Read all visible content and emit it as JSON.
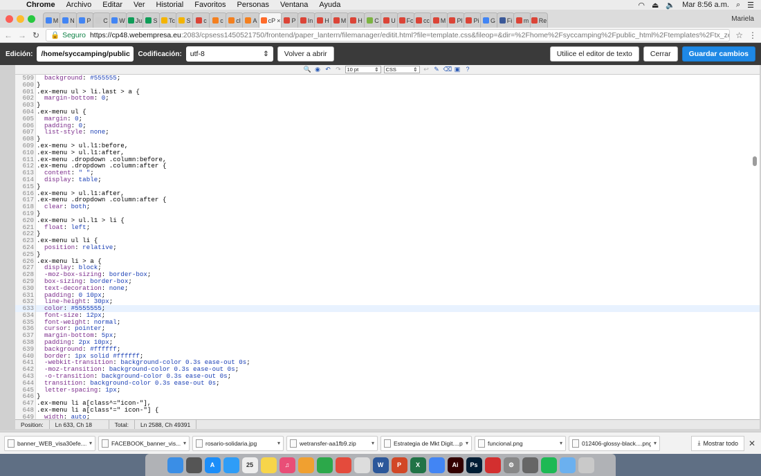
{
  "menubar": {
    "app": "Chrome",
    "items": [
      "Archivo",
      "Editar",
      "Ver",
      "Historial",
      "Favoritos",
      "Personas",
      "Ventana",
      "Ayuda"
    ],
    "clock": "Mar 8:56 a.m."
  },
  "tabs": [
    {
      "label": "M",
      "color": "#4285f4"
    },
    {
      "label": "N",
      "color": "#4285f4"
    },
    {
      "label": "P",
      "color": "#4285f4"
    },
    {
      "label": "C",
      "color": "#cccccc"
    },
    {
      "label": "W",
      "color": "#4285f4"
    },
    {
      "label": "Ju",
      "color": "#0f9d58"
    },
    {
      "label": "S",
      "color": "#0f9d58"
    },
    {
      "label": "Tc",
      "color": "#f4b400"
    },
    {
      "label": "S",
      "color": "#f4b400"
    },
    {
      "label": "c",
      "color": "#db4437"
    },
    {
      "label": "c",
      "color": "#f4801f"
    },
    {
      "label": "cl",
      "color": "#f4801f"
    },
    {
      "label": "A",
      "color": "#f4801f"
    },
    {
      "label": "cP",
      "color": "#ff6c2c",
      "active": true
    },
    {
      "label": "P",
      "color": "#db4437"
    },
    {
      "label": "In",
      "color": "#db4437"
    },
    {
      "label": "H",
      "color": "#db4437"
    },
    {
      "label": "M",
      "color": "#db4437"
    },
    {
      "label": "H",
      "color": "#db4437"
    },
    {
      "label": "C",
      "color": "#7cb342"
    },
    {
      "label": "U",
      "color": "#db4437"
    },
    {
      "label": "Fc",
      "color": "#db4437"
    },
    {
      "label": "cc",
      "color": "#db4437"
    },
    {
      "label": "M",
      "color": "#db4437"
    },
    {
      "label": "Pl",
      "color": "#db4437"
    },
    {
      "label": "Pi",
      "color": "#db4437"
    },
    {
      "label": "G",
      "color": "#4285f4"
    },
    {
      "label": "Fi",
      "color": "#3b5998"
    },
    {
      "label": "m",
      "color": "#db4437"
    },
    {
      "label": "Re",
      "color": "#db4437"
    }
  ],
  "profile": "Mariela",
  "address": {
    "secure_label": "Seguro",
    "host": "https://cp48.webempresa.eu",
    "path": ":2083/cpsess1450521750/frontend/paper_lantern/filemanager/editit.html?file=template.css&fileop=&dir=%2Fhome%2Fsyccamping%2Fpublic_html%2Ftemplates%2Ftx_zenith%2Fcss&d..."
  },
  "editor_header": {
    "edit_label": "Edición:",
    "path": "/home/syccamping/public",
    "encoding_label": "Codificación:",
    "encoding": "utf-8",
    "reopen": "Volver a abrir",
    "use_text_editor": "Utilice el editor de texto",
    "close": "Cerrar",
    "save": "Guardar cambios"
  },
  "toolbar": {
    "font_size": "10 pt",
    "syntax": "CSS"
  },
  "code": [
    {
      "n": "599",
      "t": "  background: #555555;"
    },
    {
      "n": "600",
      "t": "}"
    },
    {
      "n": "601",
      "t": ".ex-menu ul > li.last > a {"
    },
    {
      "n": "602",
      "t": "  margin-bottom: 0;"
    },
    {
      "n": "603",
      "t": "}"
    },
    {
      "n": "604",
      "t": ".ex-menu ul {"
    },
    {
      "n": "605",
      "t": "  margin: 0;"
    },
    {
      "n": "606",
      "t": "  padding: 0;"
    },
    {
      "n": "607",
      "t": "  list-style: none;"
    },
    {
      "n": "608",
      "t": "}"
    },
    {
      "n": "609",
      "t": ".ex-menu > ul.l1:before,"
    },
    {
      "n": "610",
      "t": ".ex-menu > ul.l1:after,"
    },
    {
      "n": "611",
      "t": ".ex-menu .dropdown .column:before,"
    },
    {
      "n": "612",
      "t": ".ex-menu .dropdown .column:after {"
    },
    {
      "n": "613",
      "t": "  content: \" \";"
    },
    {
      "n": "614",
      "t": "  display: table;"
    },
    {
      "n": "615",
      "t": "}"
    },
    {
      "n": "616",
      "t": ".ex-menu > ul.l1:after,"
    },
    {
      "n": "617",
      "t": ".ex-menu .dropdown .column:after {"
    },
    {
      "n": "618",
      "t": "  clear: both;"
    },
    {
      "n": "619",
      "t": "}"
    },
    {
      "n": "620",
      "t": ".ex-menu > ul.l1 > li {"
    },
    {
      "n": "621",
      "t": "  float: left;"
    },
    {
      "n": "622",
      "t": "}"
    },
    {
      "n": "623",
      "t": ".ex-menu ul li {"
    },
    {
      "n": "624",
      "t": "  position: relative;"
    },
    {
      "n": "625",
      "t": "}"
    },
    {
      "n": "626",
      "t": ".ex-menu li > a {"
    },
    {
      "n": "627",
      "t": "  display: block;"
    },
    {
      "n": "628",
      "t": "  -moz-box-sizing: border-box;"
    },
    {
      "n": "629",
      "t": "  box-sizing: border-box;"
    },
    {
      "n": "630",
      "t": "  text-decoration: none;"
    },
    {
      "n": "631",
      "t": "  padding: 0 10px;"
    },
    {
      "n": "632",
      "t": "  line-height: 30px;"
    },
    {
      "n": "633",
      "t": "  color: #5555555;",
      "active": true
    },
    {
      "n": "634",
      "t": "  font-size: 12px;"
    },
    {
      "n": "635",
      "t": "  font-weight: normal;"
    },
    {
      "n": "636",
      "t": "  cursor: pointer;"
    },
    {
      "n": "637",
      "t": "  margin-bottom: 5px;"
    },
    {
      "n": "638",
      "t": "  padding: 2px 10px;"
    },
    {
      "n": "639",
      "t": "  background: #ffffff;"
    },
    {
      "n": "640",
      "t": "  border: 1px solid #ffffff;"
    },
    {
      "n": "641",
      "t": "  -webkit-transition: background-color 0.3s ease-out 0s;"
    },
    {
      "n": "642",
      "t": "  -moz-transition: background-color 0.3s ease-out 0s;"
    },
    {
      "n": "643",
      "t": "  -o-transition: background-color 0.3s ease-out 0s;"
    },
    {
      "n": "644",
      "t": "  transition: background-color 0.3s ease-out 0s;"
    },
    {
      "n": "645",
      "t": "  letter-spacing: 1px;"
    },
    {
      "n": "646",
      "t": "}"
    },
    {
      "n": "647",
      "t": ".ex-menu li a[class^=\"icon-\"],"
    },
    {
      "n": "648",
      "t": ".ex-menu li a[class*=\" icon-\"] {"
    },
    {
      "n": "649",
      "t": "  width: auto;"
    }
  ],
  "status": {
    "position_label": "Position:",
    "position": "Ln 633, Ch 18",
    "total_label": "Total:",
    "total": "Ln 2588, Ch 49391"
  },
  "downloads": [
    "banner_WEB_visa30efe....jpg",
    "FACEBOOK_banner_vis....jpg",
    "rosario-solidaria.jpg",
    "wetransfer-aa1fb9.zip",
    "Estrategia de Mkt Digit....pdf",
    "funcional.png",
    "012406-glossy-black....png"
  ],
  "show_all": "Mostrar todo",
  "dock": [
    {
      "icon": "finder-icon",
      "color": "#3a8ee6",
      "label": ""
    },
    {
      "icon": "launchpad-icon",
      "color": "#555",
      "label": ""
    },
    {
      "icon": "appstore-icon",
      "color": "#1c8ef9",
      "label": "A"
    },
    {
      "icon": "safari-icon",
      "color": "#2e9df7",
      "label": ""
    },
    {
      "icon": "calendar-icon",
      "color": "#eeeeee",
      "label": "25"
    },
    {
      "icon": "notes-icon",
      "color": "#f7d54a",
      "label": ""
    },
    {
      "icon": "itunes-icon",
      "color": "#e94e77",
      "label": "♫"
    },
    {
      "icon": "photos-icon",
      "color": "#f0a030",
      "label": ""
    },
    {
      "icon": "facetime-icon",
      "color": "#2ca84a",
      "label": ""
    },
    {
      "icon": "maps-icon",
      "color": "#e44b3c",
      "label": ""
    },
    {
      "icon": "preview-icon",
      "color": "#dddddd",
      "label": ""
    },
    {
      "icon": "word-icon",
      "color": "#2b579a",
      "label": "W"
    },
    {
      "icon": "powerpoint-icon",
      "color": "#d24726",
      "label": "P"
    },
    {
      "icon": "excel-icon",
      "color": "#217346",
      "label": "X"
    },
    {
      "icon": "chrome-icon",
      "color": "#4285f4",
      "label": ""
    },
    {
      "icon": "illustrator-icon",
      "color": "#330000",
      "label": "Ai"
    },
    {
      "icon": "photoshop-icon",
      "color": "#001d34",
      "label": "Ps"
    },
    {
      "icon": "acrobat-icon",
      "color": "#d32f2f",
      "label": ""
    },
    {
      "icon": "settings-icon",
      "color": "#888888",
      "label": "⚙"
    },
    {
      "icon": "app-icon",
      "color": "#666666",
      "label": ""
    },
    {
      "icon": "spotify-icon",
      "color": "#1db954",
      "label": ""
    },
    {
      "icon": "folder-icon",
      "color": "#6bb0ef",
      "label": ""
    },
    {
      "icon": "trash-icon",
      "color": "#c9c9c9",
      "label": ""
    }
  ]
}
